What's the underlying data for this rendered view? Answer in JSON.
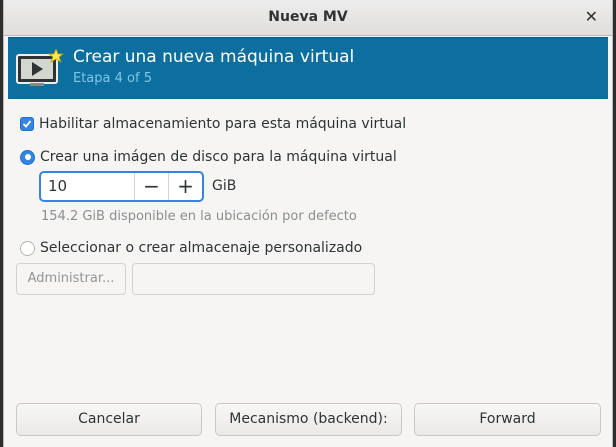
{
  "window": {
    "title": "Nueva MV"
  },
  "header": {
    "title": "Crear una nueva máquina virtual",
    "step": "Etapa 4 of 5",
    "accent_color": "#0c6fa0"
  },
  "storage": {
    "enable_label": "Habilitar almacenamiento para esta máquina virtual",
    "enable_checked": true,
    "create_image_label": "Crear una imágen de disco para la máquina virtual",
    "create_image_selected": true,
    "size_value": "10",
    "size_unit": "GiB",
    "available_hint": "154.2 GiB disponible en la ubicación por defecto",
    "custom_label": "Seleccionar o crear almacenaje personalizado",
    "custom_selected": false,
    "manage_label": "Administrar...",
    "path_value": ""
  },
  "footer": {
    "cancel_label": "Cancelar",
    "backend_label": "Mecanismo (backend):",
    "forward_label": "Forward"
  }
}
